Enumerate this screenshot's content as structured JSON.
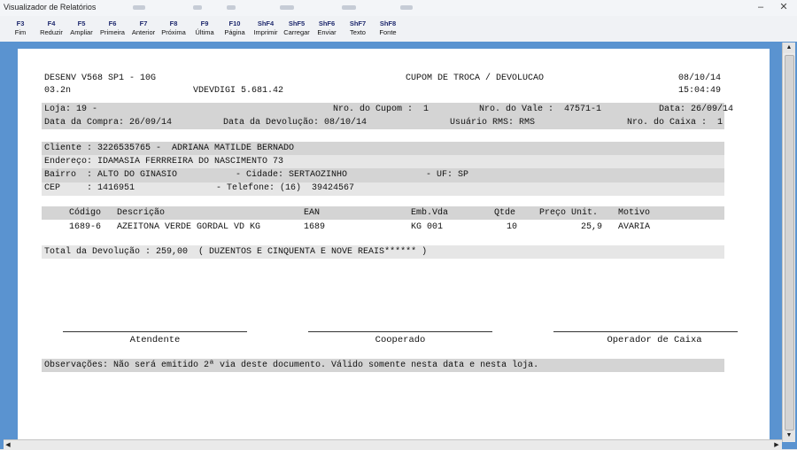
{
  "window": {
    "title": "Visualizador de Relatórios"
  },
  "toolbar": [
    {
      "key": "F3",
      "label": "Fim"
    },
    {
      "key": "F4",
      "label": "Reduzir"
    },
    {
      "key": "F5",
      "label": "Ampliar"
    },
    {
      "key": "F6",
      "label": "Primeira"
    },
    {
      "key": "F7",
      "label": "Anterior"
    },
    {
      "key": "F8",
      "label": "Próxima"
    },
    {
      "key": "F9",
      "label": "Última"
    },
    {
      "key": "F10",
      "label": "Página"
    },
    {
      "key": "ShF4",
      "label": "Imprimir"
    },
    {
      "key": "ShF5",
      "label": "Carregar"
    },
    {
      "key": "ShF6",
      "label": "Enviar"
    },
    {
      "key": "ShF7",
      "label": "Texto"
    },
    {
      "key": "ShF8",
      "label": "Fonte"
    }
  ],
  "report": {
    "system": "DESENV V568 SP1 - 10G",
    "version_code": "03.2n",
    "program": "VDEVDIGI 5.681.42",
    "title": "CUPOM DE TROCA / DEVOLUCAO",
    "date": "08/10/14",
    "time": "15:04:49",
    "loja": "Loja: 19 -",
    "nro_cupom": "Nro. do Cupom :  1",
    "nro_vale": "Nro. do Vale :  47571-1",
    "data_top": "Data: 26/09/14",
    "data_compra": "Data da Compra: 26/09/14",
    "data_devolucao": "Data da Devolução: 08/10/14",
    "usuario": "Usuário RMS: RMS",
    "nro_caixa": "Nro. do Caixa :  1",
    "cliente": "Cliente : 3226535765 -  ADRIANA MATILDE BERNADO",
    "endereco": "Endereço: IDAMASIA FERRREIRA DO NASCIMENTO 73",
    "bairro": "Bairro  : ALTO DO GINASIO",
    "cidade": "- Cidade: SERTAOZINHO",
    "uf": "- UF: SP",
    "cep": "CEP     : 1416951",
    "telefone": "- Telefone: (16)  39424567",
    "items_header": {
      "codigo": "Código",
      "descricao": "Descrição",
      "ean": "EAN",
      "emb": "Emb.Vda",
      "qtde": "Qtde",
      "preco": "Preço Unit.",
      "motivo": "Motivo"
    },
    "items": [
      {
        "codigo": "1689-6",
        "descricao": "AZEITONA VERDE GORDAL VD KG",
        "ean": "1689",
        "emb": "KG 001",
        "qtde": "10",
        "preco": "25,9",
        "motivo": "AVARIA"
      }
    ],
    "total": "Total da Devolução : 259,00  ( DUZENTOS E CINQUENTA E NOVE REAIS****** )",
    "signatures": {
      "atendente": "Atendente",
      "cooperado": "Cooperado",
      "operador": "Operador de Caixa"
    },
    "observacoes": "Observações: Não será emitido 2ª via deste documento. Válido somente nesta data e nesta loja."
  }
}
